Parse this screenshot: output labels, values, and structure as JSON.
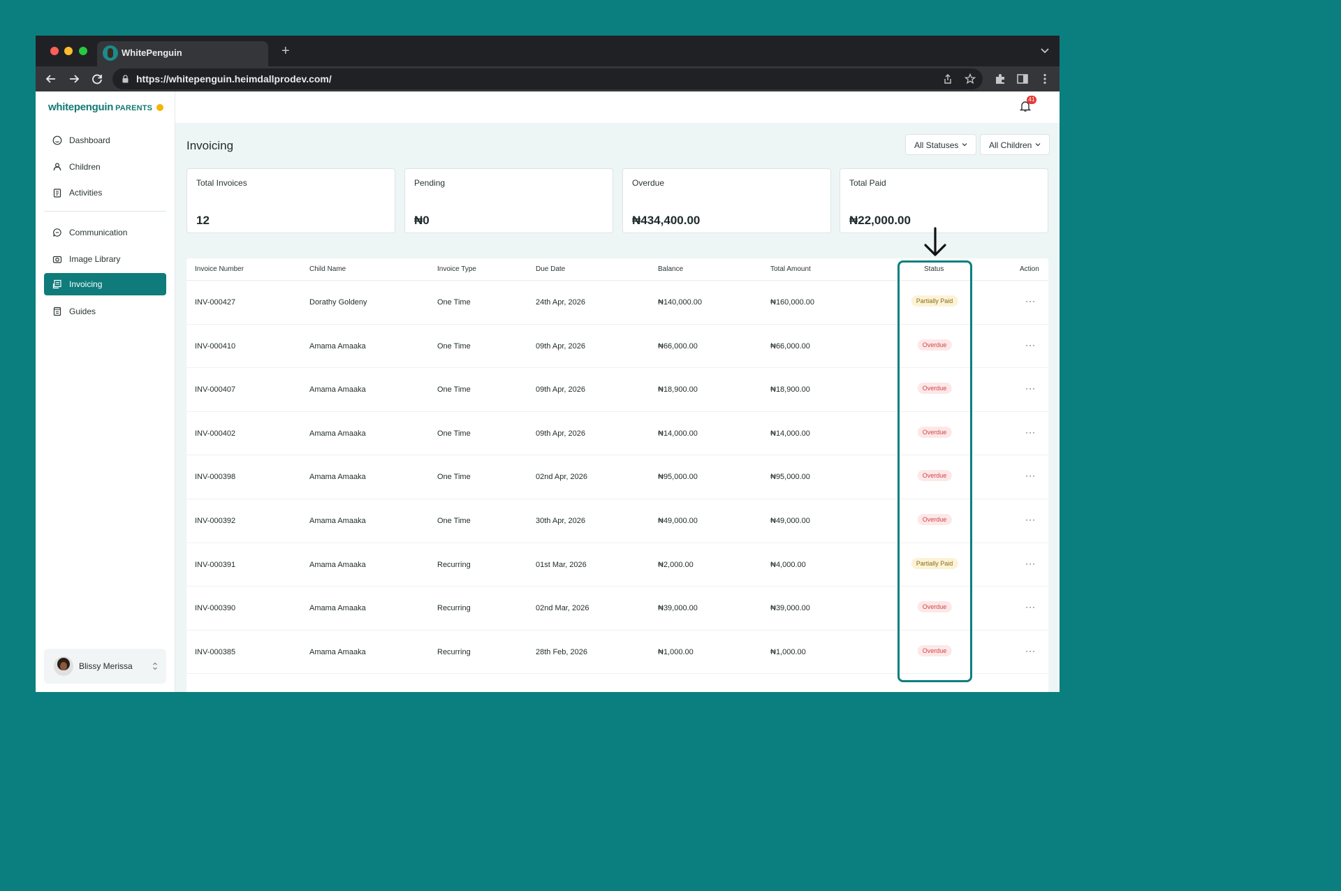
{
  "browser": {
    "tab_title": "WhitePenguin",
    "new_tab_icon": "plus-icon",
    "url": "https://whitepenguin.heimdallprodev.com/"
  },
  "brand": {
    "name": "whitepenguin",
    "suffix": "PARENTS"
  },
  "sidebar": {
    "items": [
      {
        "label": "Dashboard",
        "icon": "dashboard-icon"
      },
      {
        "label": "Children",
        "icon": "children-icon"
      },
      {
        "label": "Activities",
        "icon": "clipboard-icon"
      },
      {
        "label": "Communication",
        "icon": "chat-icon"
      },
      {
        "label": "Image Library",
        "icon": "camera-icon"
      },
      {
        "label": "Invoicing",
        "icon": "invoice-icon",
        "active": true
      },
      {
        "label": "Guides",
        "icon": "book-icon"
      }
    ],
    "user": {
      "name": "Blissy Merissa"
    }
  },
  "header": {
    "notification_count": "41"
  },
  "page": {
    "title": "Invoicing",
    "filters": {
      "status": "All Statuses",
      "children": "All Children"
    }
  },
  "cards": [
    {
      "label": "Total Invoices",
      "value": "12"
    },
    {
      "label": "Pending",
      "value": "₦0"
    },
    {
      "label": "Overdue",
      "value": "₦434,400.00"
    },
    {
      "label": "Total Paid",
      "value": "₦22,000.00"
    }
  ],
  "table": {
    "columns": [
      "Invoice Number",
      "Child Name",
      "Invoice Type",
      "Due Date",
      "Balance",
      "Total Amount",
      "Status",
      "Action"
    ],
    "rows": [
      {
        "number": "INV-000427",
        "child": "Dorathy Goldeny",
        "type": "One Time",
        "due": "24th Apr, 2026",
        "balance": "₦140,000.00",
        "total": "₦160,000.00",
        "status": "Partially Paid"
      },
      {
        "number": "INV-000410",
        "child": "Amama Amaaka",
        "type": "One Time",
        "due": "09th Apr, 2026",
        "balance": "₦66,000.00",
        "total": "₦66,000.00",
        "status": "Overdue"
      },
      {
        "number": "INV-000407",
        "child": "Amama Amaaka",
        "type": "One Time",
        "due": "09th Apr, 2026",
        "balance": "₦18,900.00",
        "total": "₦18,900.00",
        "status": "Overdue"
      },
      {
        "number": "INV-000402",
        "child": "Amama Amaaka",
        "type": "One Time",
        "due": "09th Apr, 2026",
        "balance": "₦14,000.00",
        "total": "₦14,000.00",
        "status": "Overdue"
      },
      {
        "number": "INV-000398",
        "child": "Amama Amaaka",
        "type": "One Time",
        "due": "02nd Apr, 2026",
        "balance": "₦95,000.00",
        "total": "₦95,000.00",
        "status": "Overdue"
      },
      {
        "number": "INV-000392",
        "child": "Amama Amaaka",
        "type": "One Time",
        "due": "30th Apr, 2026",
        "balance": "₦49,000.00",
        "total": "₦49,000.00",
        "status": "Overdue"
      },
      {
        "number": "INV-000391",
        "child": "Amama Amaaka",
        "type": "Recurring",
        "due": "01st Mar, 2026",
        "balance": "₦2,000.00",
        "total": "₦4,000.00",
        "status": "Partially Paid"
      },
      {
        "number": "INV-000390",
        "child": "Amama Amaaka",
        "type": "Recurring",
        "due": "02nd Mar, 2026",
        "balance": "₦39,000.00",
        "total": "₦39,000.00",
        "status": "Overdue"
      },
      {
        "number": "INV-000385",
        "child": "Amama Amaaka",
        "type": "Recurring",
        "due": "28th Feb, 2026",
        "balance": "₦1,000.00",
        "total": "₦1,000.00",
        "status": "Overdue"
      }
    ],
    "action_label": "···"
  },
  "colors": {
    "background": "#0b7f7f",
    "brand": "#137a73",
    "active_nav": "#0f7b7b",
    "partial_bg": "#fcf3d7",
    "partial_text": "#8a6d12",
    "overdue_bg": "#fde7e7",
    "overdue_text": "#d04646"
  }
}
